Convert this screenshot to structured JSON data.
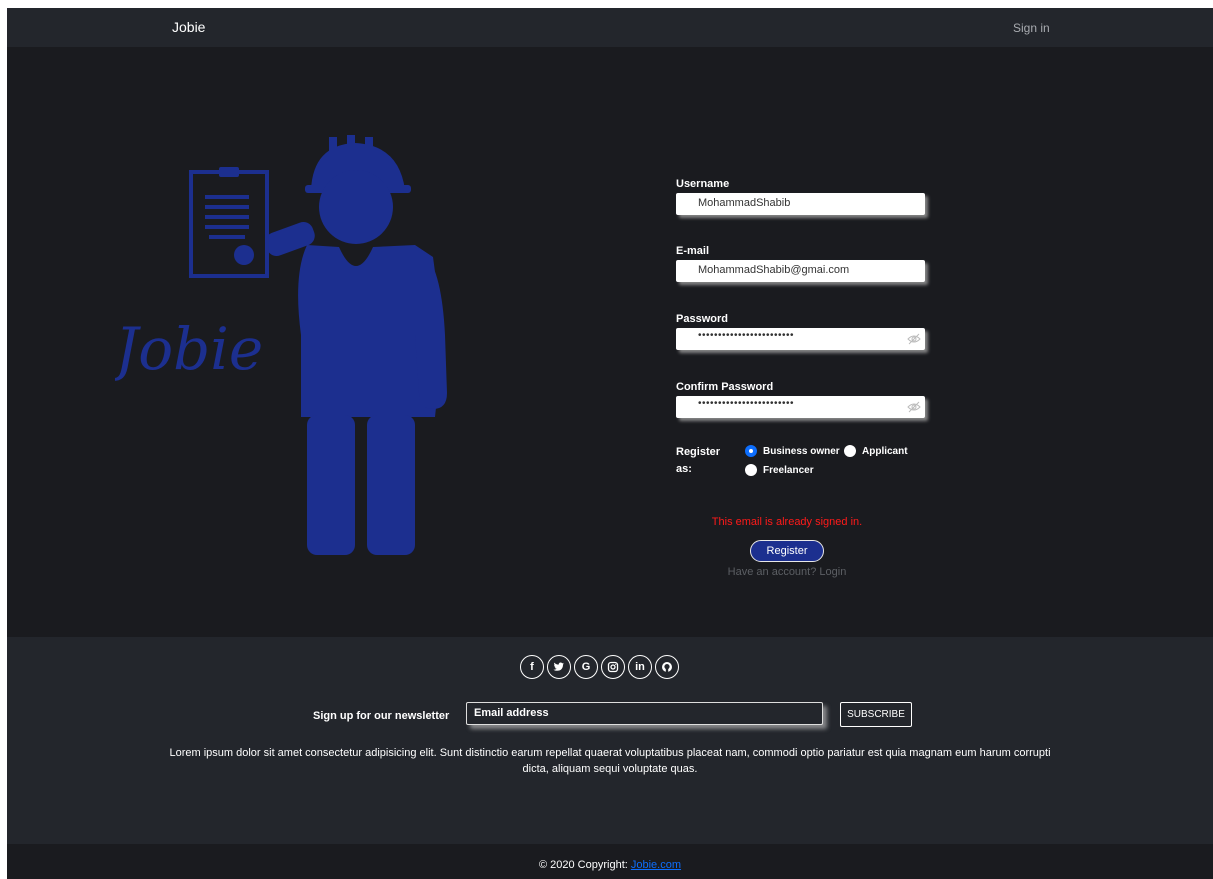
{
  "navbar": {
    "brand": "Jobie",
    "signin": "Sign in"
  },
  "illustration": {
    "logo_text": "Jobie",
    "color": "#1c2f8f"
  },
  "form": {
    "username_label": "Username",
    "username_value": "MohammadShabib",
    "email_label": "E-mail",
    "email_value": "MohammadShabib@gmai.com",
    "password_label": "Password",
    "password_mask": "••••••••••••••••••••••••",
    "confirm_label": "Confirm Password",
    "confirm_mask": "••••••••••••••••••••••••",
    "register_as_label": "Register as:",
    "roles": [
      {
        "label": "Business owner",
        "selected": true
      },
      {
        "label": "Applicant",
        "selected": false
      },
      {
        "label": "Freelancer",
        "selected": false
      }
    ],
    "error": "This email is already signed in.",
    "register_button": "Register",
    "login_link": "Have an account? Login"
  },
  "footer": {
    "socials": [
      "facebook-icon",
      "twitter-icon",
      "google-icon",
      "instagram-icon",
      "linkedin-icon",
      "github-icon"
    ],
    "newsletter_label": "Sign up for our newsletter",
    "newsletter_placeholder": "Email address",
    "subscribe_button": "SUBSCRIBE",
    "lorem": "Lorem ipsum dolor sit amet consectetur adipisicing elit. Sunt distinctio earum repellat quaerat voluptatibus placeat nam, commodi optio pariatur est quia magnam eum harum corrupti dicta, aliquam sequi voluptate quas.",
    "copyright_prefix": "© 2020 Copyright:",
    "copyright_link": "Jobie.com"
  },
  "colors": {
    "accent": "#0d6efd",
    "brand_blue": "#1c2f8f",
    "error": "#ff1a1a",
    "background": "#1a1b1f",
    "panel": "#23262c"
  }
}
